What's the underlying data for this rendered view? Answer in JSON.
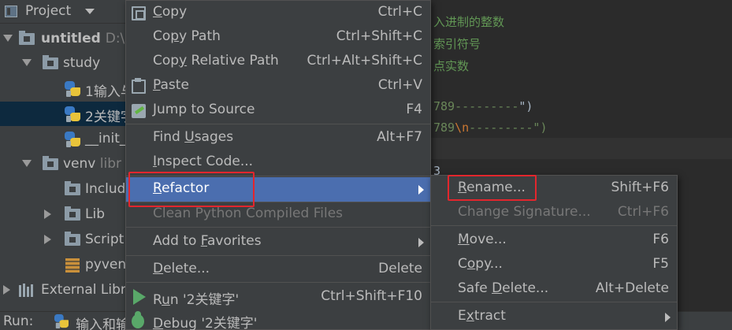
{
  "project_panel": {
    "title": "Project",
    "tree": [
      {
        "label": "untitled",
        "suffix": "D:\\",
        "kind": "folder",
        "expanded": true,
        "level": 0,
        "bold": true
      },
      {
        "label": "study",
        "kind": "folder",
        "expanded": true,
        "level": 1
      },
      {
        "label": "1输入与",
        "kind": "python",
        "level": 2
      },
      {
        "label": "2关键字",
        "kind": "python",
        "level": 2,
        "selected": true
      },
      {
        "label": "__init_",
        "kind": "python",
        "level": 2
      },
      {
        "label": "venv",
        "suffix": "libr",
        "kind": "folder",
        "expanded": true,
        "level": 0
      },
      {
        "label": "Includ",
        "kind": "folder",
        "level": 1
      },
      {
        "label": "Lib",
        "kind": "folder",
        "collapsed": true,
        "level": 1
      },
      {
        "label": "Script",
        "kind": "folder",
        "collapsed": true,
        "level": 1
      },
      {
        "label": "pyven",
        "kind": "pyvenv",
        "level": 1
      },
      {
        "label": "External Libr",
        "kind": "library",
        "collapsed": true,
        "level": 0
      }
    ]
  },
  "editor": {
    "lines": [
      {
        "text": "入进制的整数",
        "style": "comment"
      },
      {
        "text": "索引符号",
        "style": "comment"
      },
      {
        "text": "点实数",
        "style": "comment"
      },
      {
        "pre": "789---------",
        "post": "\")",
        "style": "string"
      },
      {
        "pre": "789",
        "esc": "\\n",
        "post": "---------\")",
        "style": "string"
      },
      {
        "text": "3",
        "style": "plain"
      }
    ]
  },
  "run_bar": {
    "label": "Run:",
    "config": "输入和输"
  },
  "context_menu": {
    "items": [
      {
        "id": "copy",
        "label": "Copy",
        "mnemonic_index": 0,
        "shortcut": "Ctrl+C",
        "icon": "copy-icon"
      },
      {
        "id": "copy-path",
        "label": "Copy Path",
        "mnemonic_index": 2,
        "shortcut": "Ctrl+Shift+C"
      },
      {
        "id": "copy-relative-path",
        "label": "Copy Relative Path",
        "mnemonic_index": 3,
        "shortcut": "Ctrl+Alt+Shift+C"
      },
      {
        "id": "paste",
        "label": "Paste",
        "mnemonic_index": 0,
        "shortcut": "Ctrl+V",
        "icon": "paste-icon"
      },
      {
        "id": "jump-to-source",
        "label": "Jump to Source",
        "shortcut": "F4",
        "icon": "jump-to-source-icon"
      },
      {
        "id": "find-usages",
        "label": "Find Usages",
        "mnemonic_index": 5,
        "shortcut": "Alt+F7"
      },
      {
        "id": "inspect-code",
        "label": "Inspect Code...",
        "mnemonic_index": 0,
        "shortcut": ""
      },
      {
        "id": "refactor",
        "label": "Refactor",
        "mnemonic_index": 0,
        "shortcut": "",
        "submenu": true,
        "highlighted": true
      },
      {
        "id": "clean-python",
        "label": "Clean Python Compiled Files",
        "shortcut": "",
        "disabled": true
      },
      {
        "id": "add-to-favorites",
        "label": "Add to Favorites",
        "mnemonic_index": 7,
        "shortcut": "",
        "submenu": true
      },
      {
        "id": "delete",
        "label": "Delete...",
        "mnemonic_index": 0,
        "shortcut": "Delete"
      },
      {
        "id": "run",
        "label": "Run '2关键字'",
        "mnemonic_index": 1,
        "shortcut": "Ctrl+Shift+F10",
        "icon": "run-icon"
      },
      {
        "id": "debug",
        "label": "Debug '2关键字'",
        "mnemonic_index": 0,
        "shortcut": "",
        "icon": "debug-icon"
      }
    ]
  },
  "refactor_submenu": {
    "items": [
      {
        "id": "rename",
        "label": "Rename...",
        "mnemonic_index": 0,
        "shortcut": "Shift+F6"
      },
      {
        "id": "change-signature",
        "label": "Change Signature...",
        "shortcut": "Ctrl+F6",
        "disabled": true
      },
      {
        "id": "move",
        "label": "Move...",
        "mnemonic_index": 0,
        "shortcut": "F6"
      },
      {
        "id": "copy",
        "label": "Copy...",
        "mnemonic_index": 1,
        "shortcut": "F5"
      },
      {
        "id": "safe-delete",
        "label": "Safe Delete...",
        "mnemonic_index": 5,
        "shortcut": "Alt+Delete"
      },
      {
        "id": "extract",
        "label": "Extract",
        "mnemonic_index": 1,
        "shortcut": "",
        "submenu": true
      }
    ]
  },
  "colors": {
    "menu_bg": "#3c3f41",
    "highlight": "#4b6eaf",
    "annotation_red": "#e3262d",
    "selection_tree": "#0d293e"
  }
}
